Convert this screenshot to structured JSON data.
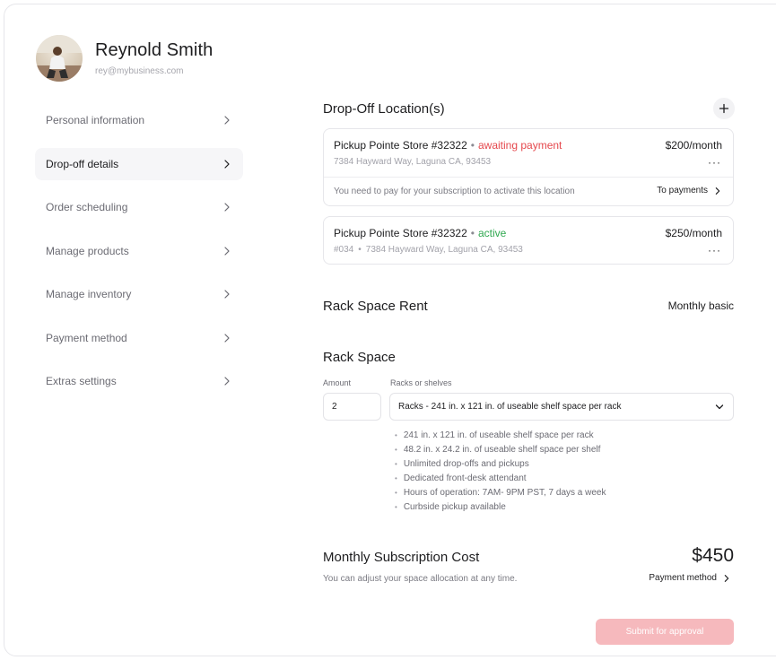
{
  "profile": {
    "name": "Reynold Smith",
    "email": "rey@mybusiness.com",
    "avatar_icon": "user-photo"
  },
  "sidebar": {
    "items": [
      {
        "label": "Personal information",
        "active": false
      },
      {
        "label": "Drop-off details",
        "active": true
      },
      {
        "label": "Order scheduling",
        "active": false
      },
      {
        "label": "Manage products",
        "active": false
      },
      {
        "label": "Manage inventory",
        "active": false
      },
      {
        "label": "Payment method",
        "active": false
      },
      {
        "label": "Extras settings",
        "active": false
      }
    ],
    "chevron_icon": "chevron-right-icon"
  },
  "dropoff": {
    "title": "Drop-Off Location(s)",
    "add_icon": "plus-icon",
    "locations": [
      {
        "store": "Pickup Pointe Store #32322",
        "status": "awaiting payment",
        "address": "7384 Hayward Way, Laguna CA, 93453",
        "price": "$200/month",
        "more": "···",
        "notice": "You need to pay for your subscription to activate this location",
        "action": "To payments"
      },
      {
        "store": "Pickup Pointe Store #32322",
        "status": "active",
        "code": "#034",
        "address": "7384 Hayward Way, Laguna CA, 93453",
        "price": "$250/month",
        "more": "···"
      }
    ]
  },
  "rent": {
    "title": "Rack Space Rent",
    "plan": "Monthly basic"
  },
  "rack": {
    "title": "Rack Space",
    "amount_label": "Amount",
    "amount_value": "2",
    "type_label": "Racks or shelves",
    "type_value": "Racks - 241 in. x 121 in. of useable shelf space per rack",
    "features": [
      "241 in. x 121 in. of useable shelf space per rack",
      "48.2 in. x 24.2 in. of useable shelf space per shelf",
      "Unlimited drop-offs and pickups",
      "Dedicated front-desk attendant",
      "Hours of operation: 7AM- 9PM PST, 7 days a week",
      "Curbside pickup available"
    ]
  },
  "cost": {
    "title": "Monthly Subscription Cost",
    "value": "$450",
    "note": "You can adjust your space allocation at any time.",
    "link": "Payment method"
  },
  "submit_label": "Submit for approval",
  "colors": {
    "awaiting": "#e5484d",
    "active": "#2fa84f",
    "submit_bg": "#f6b9bd"
  }
}
